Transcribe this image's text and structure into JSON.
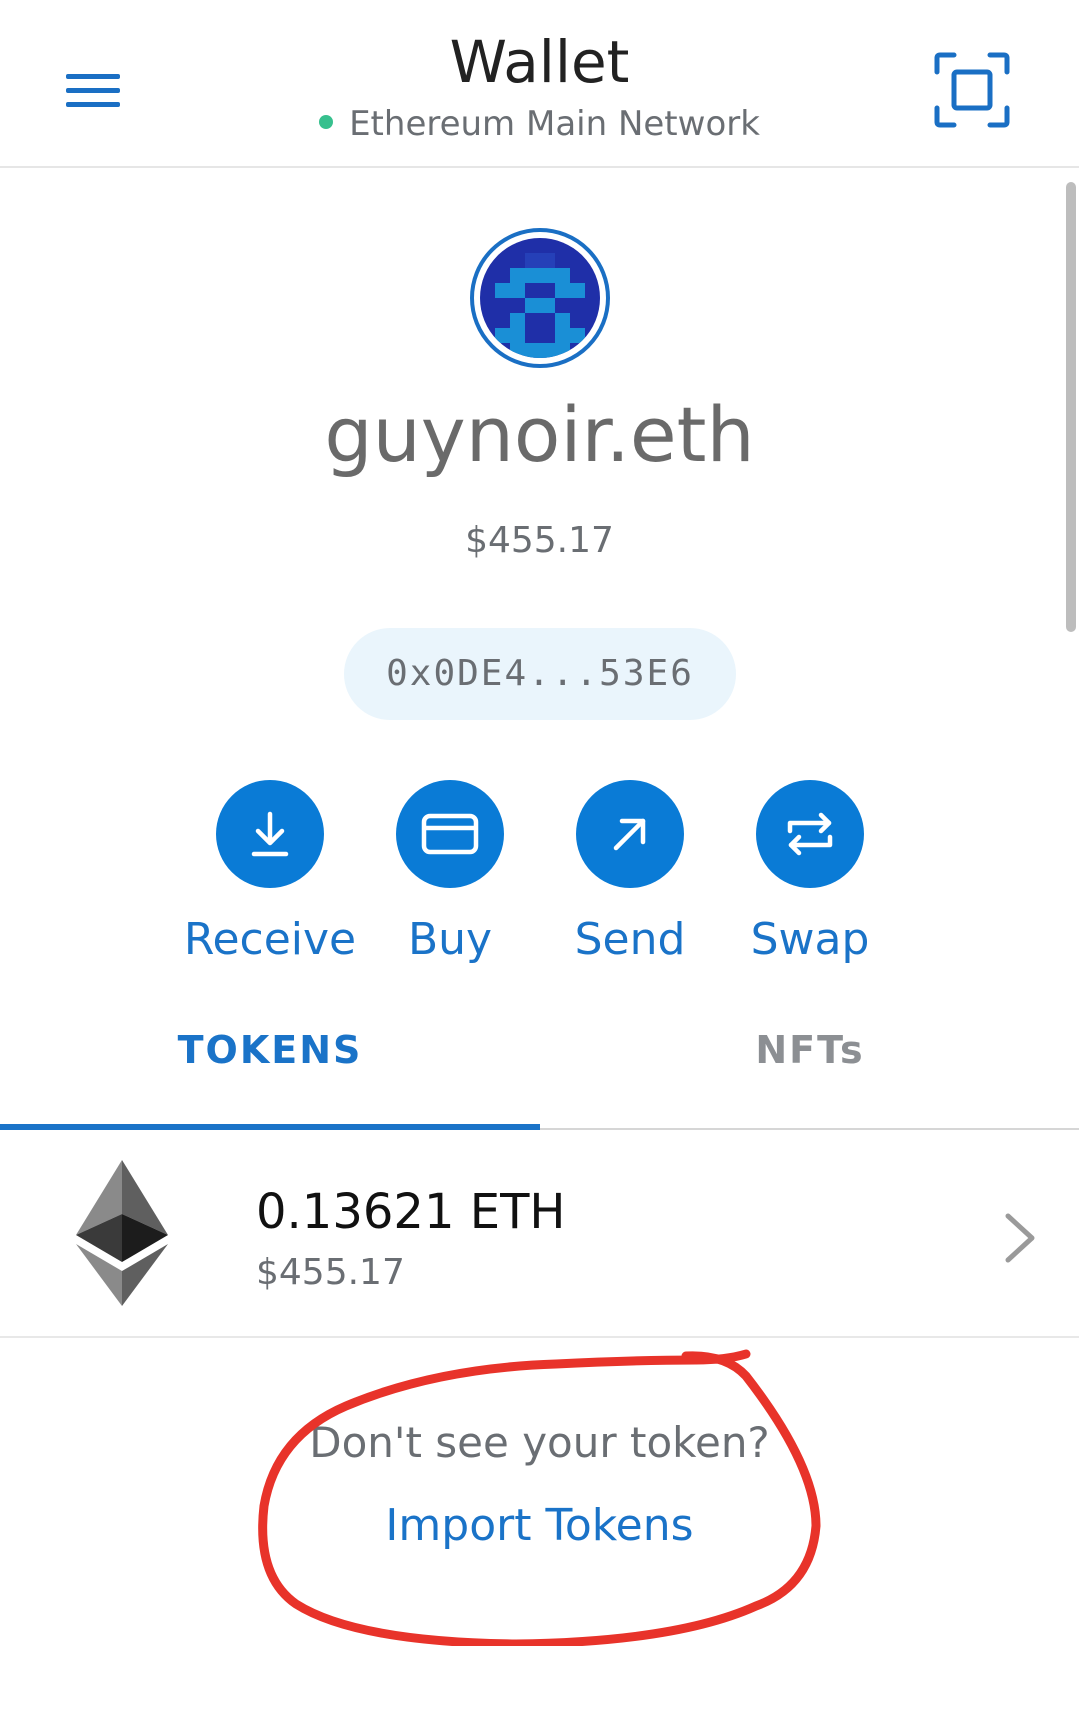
{
  "header": {
    "title": "Wallet",
    "network": "Ethereum Main Network",
    "menu_icon": "hamburger-menu-icon",
    "scan_icon": "qr-scan-icon"
  },
  "account": {
    "name": "guynoir.eth",
    "balance": "$455.17",
    "address": "0x0DE4...53E6"
  },
  "actions": [
    {
      "label": "Receive",
      "icon": "download-arrow-icon"
    },
    {
      "label": "Buy",
      "icon": "credit-card-icon"
    },
    {
      "label": "Send",
      "icon": "arrow-up-right-icon"
    },
    {
      "label": "Swap",
      "icon": "swap-arrows-icon"
    }
  ],
  "tabs": [
    {
      "label": "TOKENS",
      "active": true
    },
    {
      "label": "NFTs",
      "active": false
    }
  ],
  "tokens": [
    {
      "amount": "0.13621 ETH",
      "fiat": "$455.17",
      "icon": "ethereum-logo-icon"
    }
  ],
  "import": {
    "prompt": "Don't see your token?",
    "link": "Import Tokens"
  },
  "colors": {
    "accent": "#1a73c8",
    "button_bg": "#0a7bd6",
    "network_dot": "#37c08e",
    "address_pill_bg": "#eaf5fc",
    "annotation": "#e8332a"
  }
}
